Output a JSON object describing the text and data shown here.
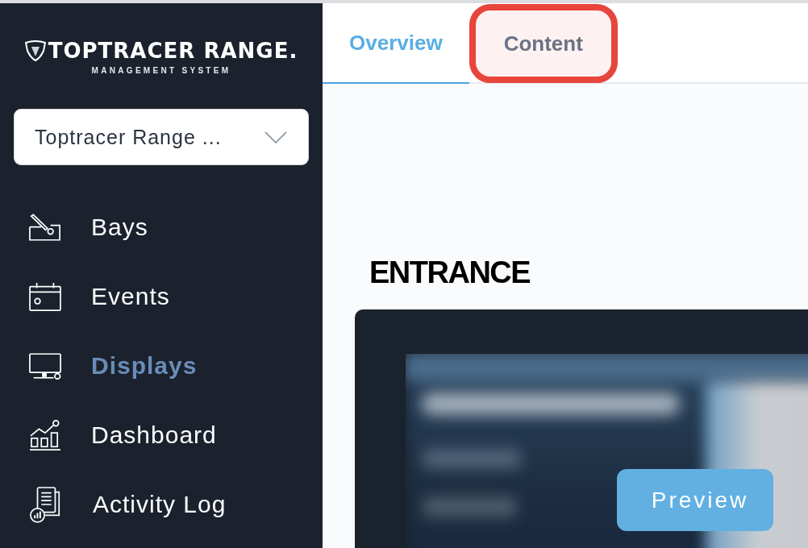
{
  "sidebar": {
    "logo": {
      "wordmark": "TOPTRACER RANGE.",
      "subtitle": "MANAGEMENT SYSTEM"
    },
    "site_select": {
      "value": "Toptracer Range ..."
    },
    "nav_items": [
      {
        "label": "Bays",
        "selected": false
      },
      {
        "label": "Events",
        "selected": false
      },
      {
        "label": "Displays",
        "selected": true
      },
      {
        "label": "Dashboard",
        "selected": false
      },
      {
        "label": "Activity Log",
        "selected": false
      }
    ]
  },
  "tabs": [
    {
      "label": "Overview",
      "selected": true,
      "highlighted": false
    },
    {
      "label": "Content",
      "selected": false,
      "highlighted": true
    }
  ],
  "section": {
    "title": "ENTRANCE",
    "preview_button": "Preview"
  }
}
